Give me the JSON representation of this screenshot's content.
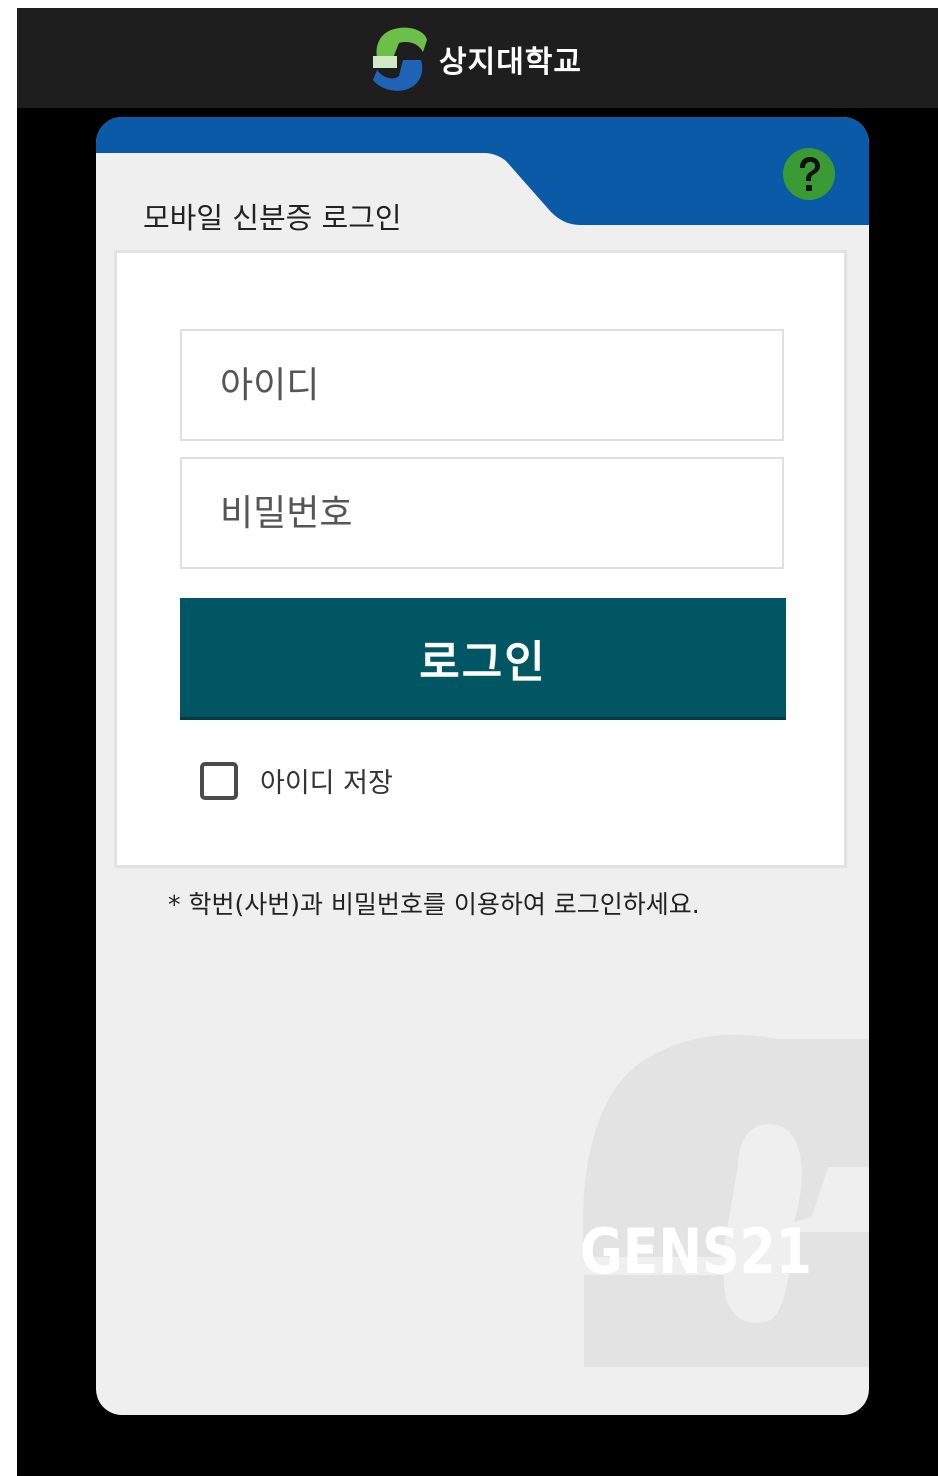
{
  "header": {
    "university_name": "상지대학교",
    "logo_icon": "sangji-s-logo"
  },
  "card": {
    "title": "모바일 신분증 로그인",
    "help_icon": "question-mark-icon",
    "accent_color": "#0b5aa8",
    "help_color": "#3a9a34"
  },
  "form": {
    "id_placeholder": "아이디",
    "id_value": "",
    "password_placeholder": "비밀번호",
    "password_value": "",
    "login_label": "로그인",
    "login_color": "#005763",
    "remember_label": "아이디 저장",
    "remember_checked": false
  },
  "notice": "* 학번(사번)과 비밀번호를 이용하여 로그인하세요.",
  "watermark": {
    "text": "GENS21",
    "icon": "gens21-s-watermark"
  }
}
